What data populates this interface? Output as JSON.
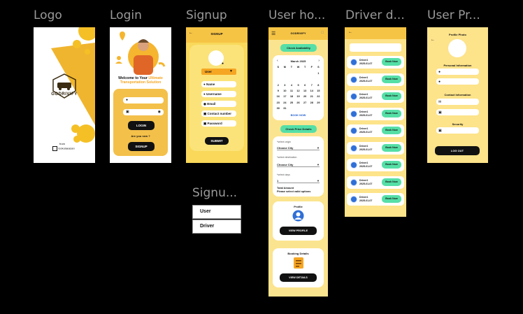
{
  "frames": {
    "logo": "Logo",
    "login": "Login",
    "signup": "Signup",
    "user_home": "User ho...",
    "driver_dash": "Driver d...",
    "user_profile": "User Pr...",
    "signup_role": "Signu..."
  },
  "logo_screen": {
    "brand": "GODRIVIFY",
    "from": "from",
    "company": "Gokulaeasan"
  },
  "login_screen": {
    "heading_prefix": "Welcome to Your ",
    "heading_highlight": "Ultimate",
    "heading_line2": "Transportation Solution",
    "login_button": "LOGIN",
    "new_prompt": "Are you new ?",
    "signup_button": "SIGNUP"
  },
  "signup_screen": {
    "title": "SIGNUP",
    "role": "User",
    "fields": [
      "Name",
      "Username",
      "Email",
      "Contact number",
      "Password"
    ],
    "submit": "SUBMIT"
  },
  "signup_role": {
    "options": [
      "User",
      "Driver"
    ]
  },
  "user_home": {
    "app_name": "GODRIVIFY",
    "check_availability": "Check Availability",
    "calendar": {
      "month": "March 2025",
      "weekdays": [
        "S",
        "M",
        "T",
        "W",
        "T",
        "F",
        "S"
      ],
      "days": [
        [
          "",
          "",
          "",
          "",
          "",
          "",
          "1"
        ],
        [
          "",
          "",
          "",
          "",
          "",
          "",
          ""
        ],
        [
          "2",
          "3",
          "4",
          "5",
          "6",
          "7",
          "8"
        ],
        [
          "9",
          "10",
          "11",
          "12",
          "13",
          "14",
          "15"
        ],
        [
          "16",
          "17",
          "18",
          "19",
          "20",
          "21",
          "22"
        ],
        [
          "23",
          "24",
          "25",
          "26",
          "27",
          "28",
          "29"
        ],
        [
          "30",
          "31",
          "",
          "",
          "",
          "",
          ""
        ]
      ],
      "book_now": "BOOK NOW"
    },
    "check_price": "Check Price Details",
    "select_origin": "*select origin",
    "choose_city_1": "Choose City",
    "select_destination": "*select destination",
    "choose_city_2": "Choose City",
    "select_days": "*select days",
    "days_value": "1",
    "total_amount": "Total Amount",
    "select_valid": "Please select valid options",
    "profile_label": "Profile",
    "view_profile": "VIEW PROFILE",
    "booking_label": "Booking Details",
    "view_details": "VIEW DETAILS"
  },
  "driver_dash": {
    "items": [
      {
        "name": "Driver1",
        "date": "2025-01-07",
        "action": "Book Now"
      },
      {
        "name": "Driver1",
        "date": "2025-01-07",
        "action": "Book Now"
      },
      {
        "name": "Driver1",
        "date": "2025-01-07",
        "action": "Book Now"
      },
      {
        "name": "Driver1",
        "date": "2025-01-07",
        "action": "Book Now"
      },
      {
        "name": "Driver1",
        "date": "2025-01-07",
        "action": "Book Now"
      },
      {
        "name": "Driver1",
        "date": "2025-01-07",
        "action": "Book Now"
      },
      {
        "name": "Driver1",
        "date": "2025-01-07",
        "action": "Book Now"
      },
      {
        "name": "Driver1",
        "date": "2025-01-07",
        "action": "Book Now"
      },
      {
        "name": "Driver1",
        "date": "2025-01-07",
        "action": "Book Now"
      }
    ]
  },
  "user_profile": {
    "title": "Profile Photo",
    "personal": "Personal Information",
    "contact": "Contact Information",
    "security": "Security",
    "logout": "LOG OUT"
  },
  "colors": {
    "yellow": "#f6c445",
    "light_yellow": "#fde38a",
    "green": "#55dfa7",
    "orange": "#f5a623"
  }
}
